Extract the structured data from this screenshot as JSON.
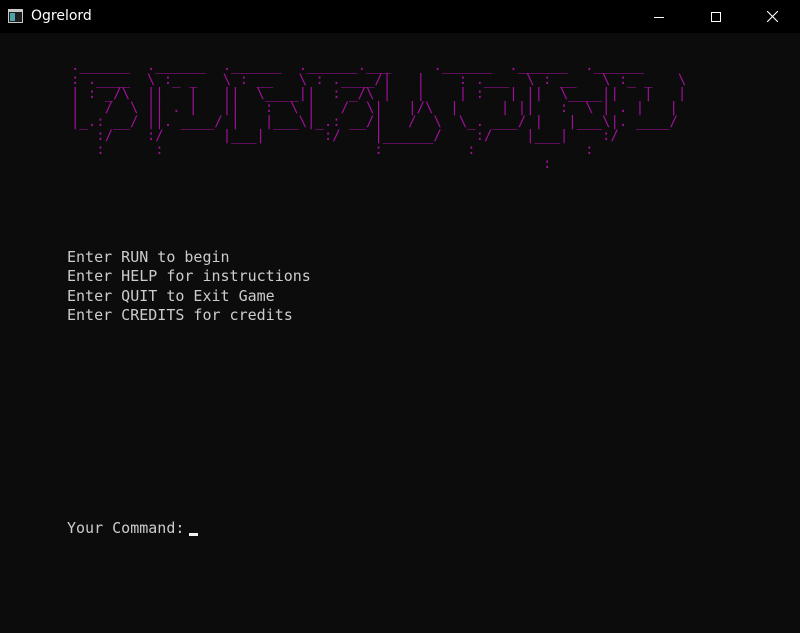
{
  "window": {
    "title": "Ogrelord",
    "icon": "console-app-icon",
    "controls": {
      "minimize_icon": "minimize-icon",
      "maximize_icon": "maximize-icon",
      "close_icon": "close-icon"
    }
  },
  "console": {
    "background": "#0c0c0c",
    "banner_color": "#a0119b",
    "text_color": "#cccccc",
    "banner_art": ".______  .______  .______  .______.___     .______  .______  .______\n: .____  \\ :_ _   \\ : __   \\ : .____/|   |    : .___  \\ : __   \\ :_ _   \\\n| : _/\\  ||   |   ||  \\____||  : _/\\ |   |    | :   | ||  \\____||   |   |\n|   /  \\ || . |   ||   :  \\ |   /  \\|   |/\\  |     | ||   :  \\ | . |   |\n|_.: __/ ||. ____/ |   |___\\|_.: __/|   /  \\  \\_. ___/ |   |___\\|. ____/\n   :/    :/       |___|       :/    |______/    :/    |___|    :/\n   :      :                         :          :             :\n                                                        :",
    "menu": [
      "Enter RUN to begin",
      "Enter HELP for instructions",
      "Enter QUIT to Exit Game",
      "Enter CREDITS for credits"
    ],
    "prompt_label": "Your Command:",
    "command_value": ""
  }
}
